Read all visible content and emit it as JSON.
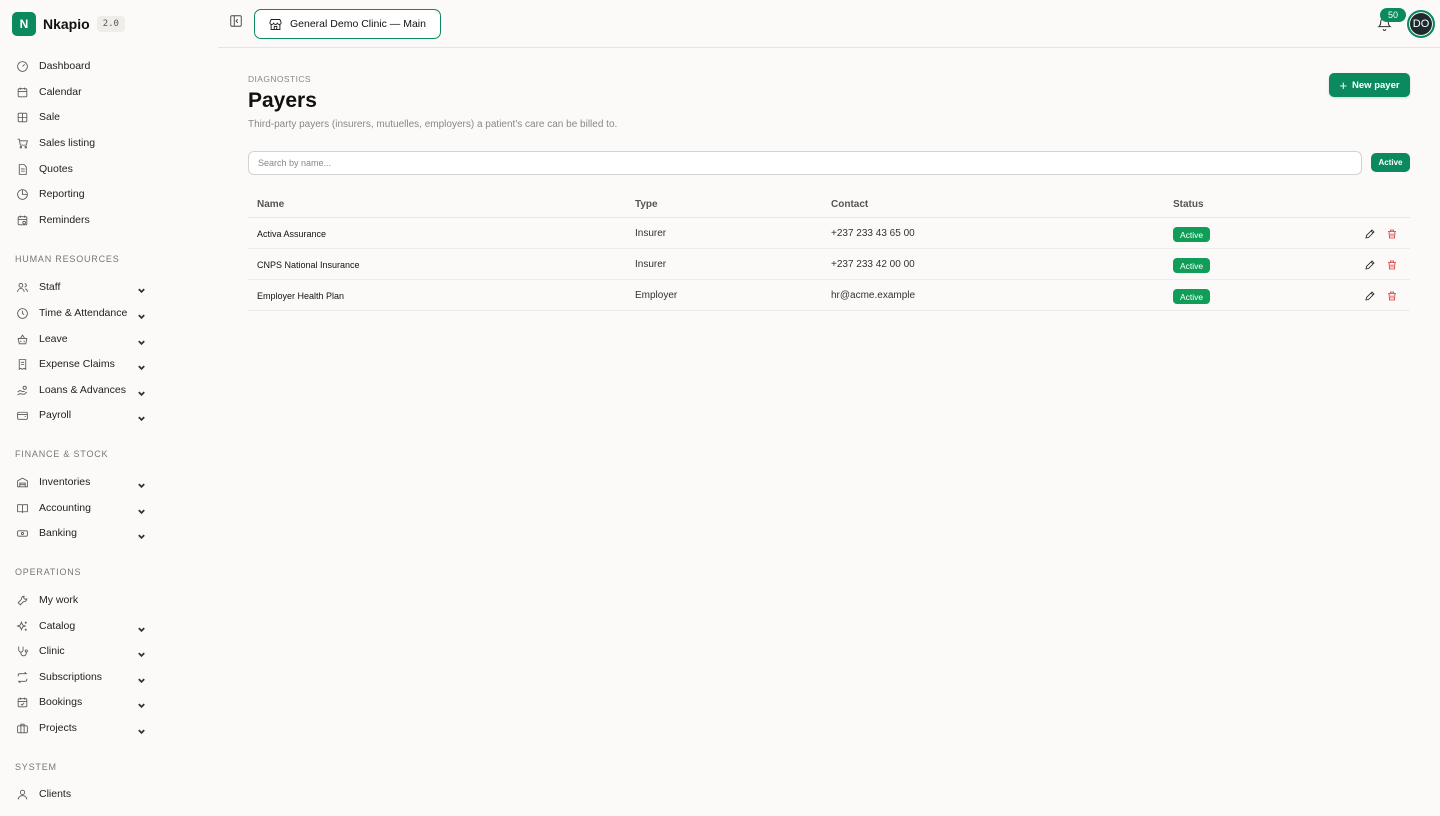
{
  "brand": {
    "logo_letter": "N",
    "name": "Nkapio",
    "version": "2.0"
  },
  "header": {
    "clinic_label": "General Demo Clinic — Main",
    "notification_count": "50",
    "avatar_initials": "DO"
  },
  "sidebar": {
    "items": [
      {
        "label": "Dashboard",
        "icon": "gauge-icon"
      },
      {
        "label": "Calendar",
        "icon": "calendar-icon"
      },
      {
        "label": "Sale",
        "icon": "grid-icon"
      },
      {
        "label": "Sales listing",
        "icon": "cart-icon"
      },
      {
        "label": "Quotes",
        "icon": "document-icon"
      },
      {
        "label": "Reporting",
        "icon": "pie-chart-icon"
      },
      {
        "label": "Reminders",
        "icon": "calendar-clock-icon"
      }
    ],
    "sections": [
      {
        "title": "HUMAN RESOURCES",
        "items": [
          "Staff",
          "Time & Attendance",
          "Leave",
          "Expense Claims",
          "Loans & Advances",
          "Payroll"
        ]
      },
      {
        "title": "FINANCE & STOCK",
        "items": [
          "Inventories",
          "Accounting",
          "Banking"
        ]
      },
      {
        "title": "OPERATIONS",
        "items": [
          "My work",
          "Catalog",
          "Clinic",
          "Subscriptions",
          "Bookings",
          "Projects"
        ]
      },
      {
        "title": "SYSTEM",
        "items": [
          "Clients"
        ]
      }
    ]
  },
  "page": {
    "eyebrow": "DIAGNOSTICS",
    "title": "Payers",
    "subtitle": "Third-party payers (insurers, mutuelles, employers) a patient's care can be billed to.",
    "new_button": "New payer",
    "search_placeholder": "Search by name...",
    "filter_label": "Active"
  },
  "table": {
    "columns": [
      "Name",
      "Type",
      "Contact",
      "Status"
    ],
    "rows": [
      {
        "name": "Activa Assurance",
        "type": "Insurer",
        "contact": "+237 233 43 65 00",
        "status": "Active"
      },
      {
        "name": "CNPS National Insurance",
        "type": "Insurer",
        "contact": "+237 233 42 00 00",
        "status": "Active"
      },
      {
        "name": "Employer Health Plan",
        "type": "Employer",
        "contact": "hr@acme.example",
        "status": "Active"
      }
    ]
  },
  "colors": {
    "accent": "#0b8a5f",
    "status_active": "#0f9d58",
    "delete": "#d93636"
  }
}
